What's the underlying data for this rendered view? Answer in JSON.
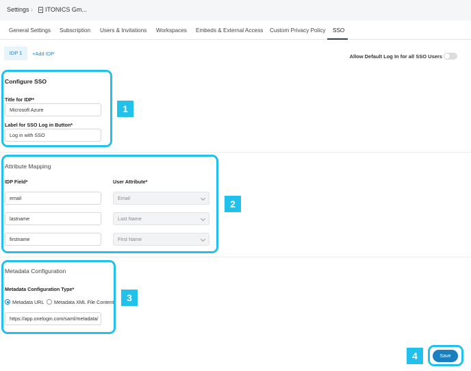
{
  "header": {
    "crumb_settings": "Settings",
    "crumb_separator": "›",
    "crumb_org": "ITONICS Gm..."
  },
  "tabs": [
    {
      "label": "General Settings"
    },
    {
      "label": "Subscription"
    },
    {
      "label": "Users & Invitations"
    },
    {
      "label": "Workspaces"
    },
    {
      "label": "Embeds & External Access"
    },
    {
      "label": "Custom Privacy Policy"
    },
    {
      "label": "SSO",
      "active": true
    }
  ],
  "idp": {
    "tab_label": "IDP 1",
    "add_label": "+Add IDP",
    "allow_default_label": "Allow Default Log In for all SSO Users",
    "allow_default_on": false
  },
  "configure": {
    "title": "Configure SSO",
    "title_label": "Title for IDP*",
    "title_value": "Microsoft Azure",
    "button_label": "Label for SSO Log in Button*",
    "button_value": "Log in with SSO"
  },
  "mapping": {
    "title": "Attribute Mapping",
    "idp_header": "IDP Field*",
    "user_header": "User Attribute*",
    "rows": [
      {
        "idp": "email",
        "user": "Email"
      },
      {
        "idp": "lastname",
        "user": "Last Name"
      },
      {
        "idp": "firstname",
        "user": "First Name"
      }
    ]
  },
  "metadata": {
    "title": "Metadata Configuration",
    "type_label": "Metadata Configuration Type*",
    "option_url": "Metadata URL",
    "option_xml": "Metadata XML File Content",
    "selected": "url",
    "url_value": "https://app.onelogin.com/saml/metadata/"
  },
  "callouts": [
    "1",
    "2",
    "3",
    "4"
  ],
  "save_label": "Save",
  "colors": {
    "highlight": "#21c1ec",
    "primary": "#1a7fbf",
    "link": "#1a85c8"
  }
}
